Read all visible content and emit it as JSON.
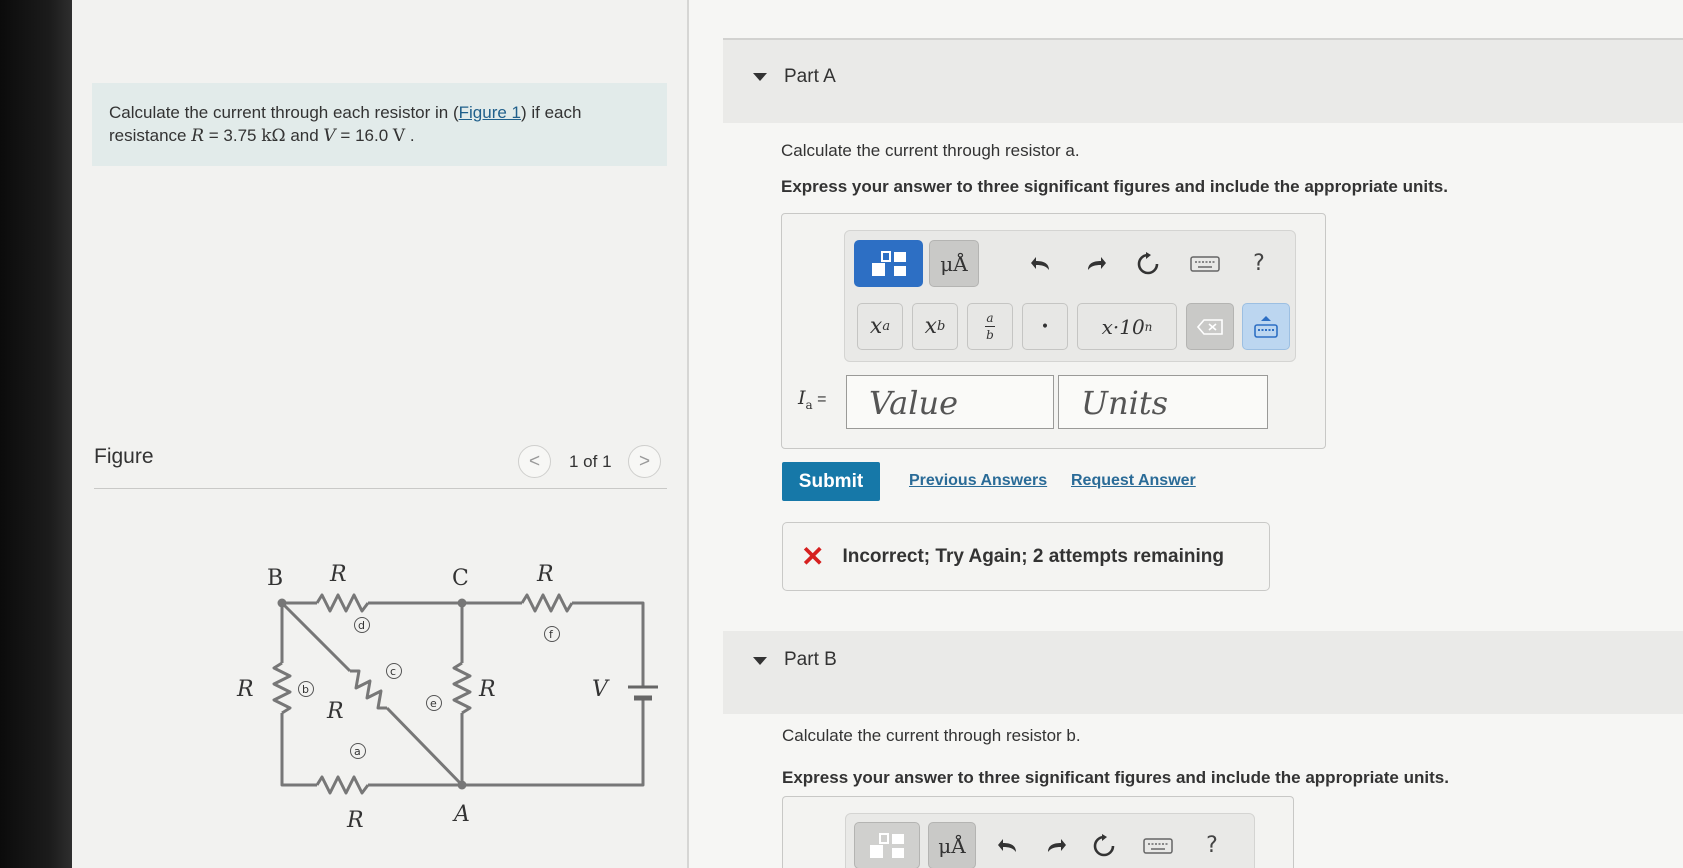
{
  "problem": {
    "text_1": "Calculate the current through each resistor in (",
    "figure_link": "Figure 1",
    "text_2": ") if each",
    "text_3": "resistance ",
    "R_sym": "R",
    "eq1": " = 3.75 ",
    "unit1": "kΩ",
    "text_4": " and ",
    "V_sym": "V",
    "eq2": " = 16.0 ",
    "unit2": "V",
    "end": " ."
  },
  "figure": {
    "title": "Figure",
    "pager": "1 of 1",
    "prev_icon": "<",
    "next_icon": ">",
    "circuit_labels": {
      "node_B": "B",
      "node_C": "C",
      "node_A": "A",
      "R": "R",
      "V": "V",
      "mark_a": "a",
      "mark_b": "b",
      "mark_c": "c",
      "mark_d": "d",
      "mark_e": "e",
      "mark_f": "f"
    }
  },
  "part_a": {
    "title": "Part A",
    "question": "Calculate the current through resistor a.",
    "instruction": "Express your answer to three significant figures and include the appropriate units.",
    "label_I": "I",
    "label_sub": "a",
    "label_eq": " =",
    "value_placeholder": "Value",
    "units_placeholder": "Units",
    "submit": "Submit",
    "previous_answers": "Previous Answers",
    "request_answer": "Request Answer",
    "feedback_icon": "✕",
    "feedback": "Incorrect; Try Again; 2 attempts remaining"
  },
  "toolbar": {
    "units_btn": "μÅ",
    "help": "?",
    "superscript_base": "x",
    "superscript_exp": "a",
    "subscript_base": "x",
    "subscript_sub": "b",
    "frac_num": "a",
    "frac_den": "b",
    "dot": "•",
    "sci_base": "x·10",
    "sci_exp": "n"
  },
  "part_b": {
    "title": "Part B",
    "question": "Calculate the current through resistor b.",
    "instruction": "Express your answer to three significant figures and include the appropriate units."
  }
}
